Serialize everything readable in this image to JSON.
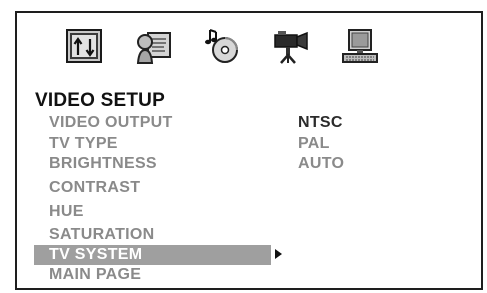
{
  "toolbar": {
    "icons": [
      {
        "name": "system-setup-icon"
      },
      {
        "name": "language-setup-icon"
      },
      {
        "name": "audio-setup-icon"
      },
      {
        "name": "video-setup-icon"
      },
      {
        "name": "preference-setup-icon"
      }
    ]
  },
  "menu": {
    "title": "VIDEO SETUP",
    "items": [
      {
        "label": "VIDEO OUTPUT"
      },
      {
        "label": "TV TYPE"
      },
      {
        "label": "BRIGHTNESS"
      },
      {
        "label": "CONTRAST"
      },
      {
        "label": "HUE"
      },
      {
        "label": "SATURATION"
      },
      {
        "label": "TV SYSTEM",
        "selected": true
      },
      {
        "label": "MAIN PAGE"
      }
    ]
  },
  "submenu": {
    "options": [
      {
        "label": "NTSC",
        "current": true
      },
      {
        "label": "PAL"
      },
      {
        "label": "AUTO"
      }
    ]
  }
}
